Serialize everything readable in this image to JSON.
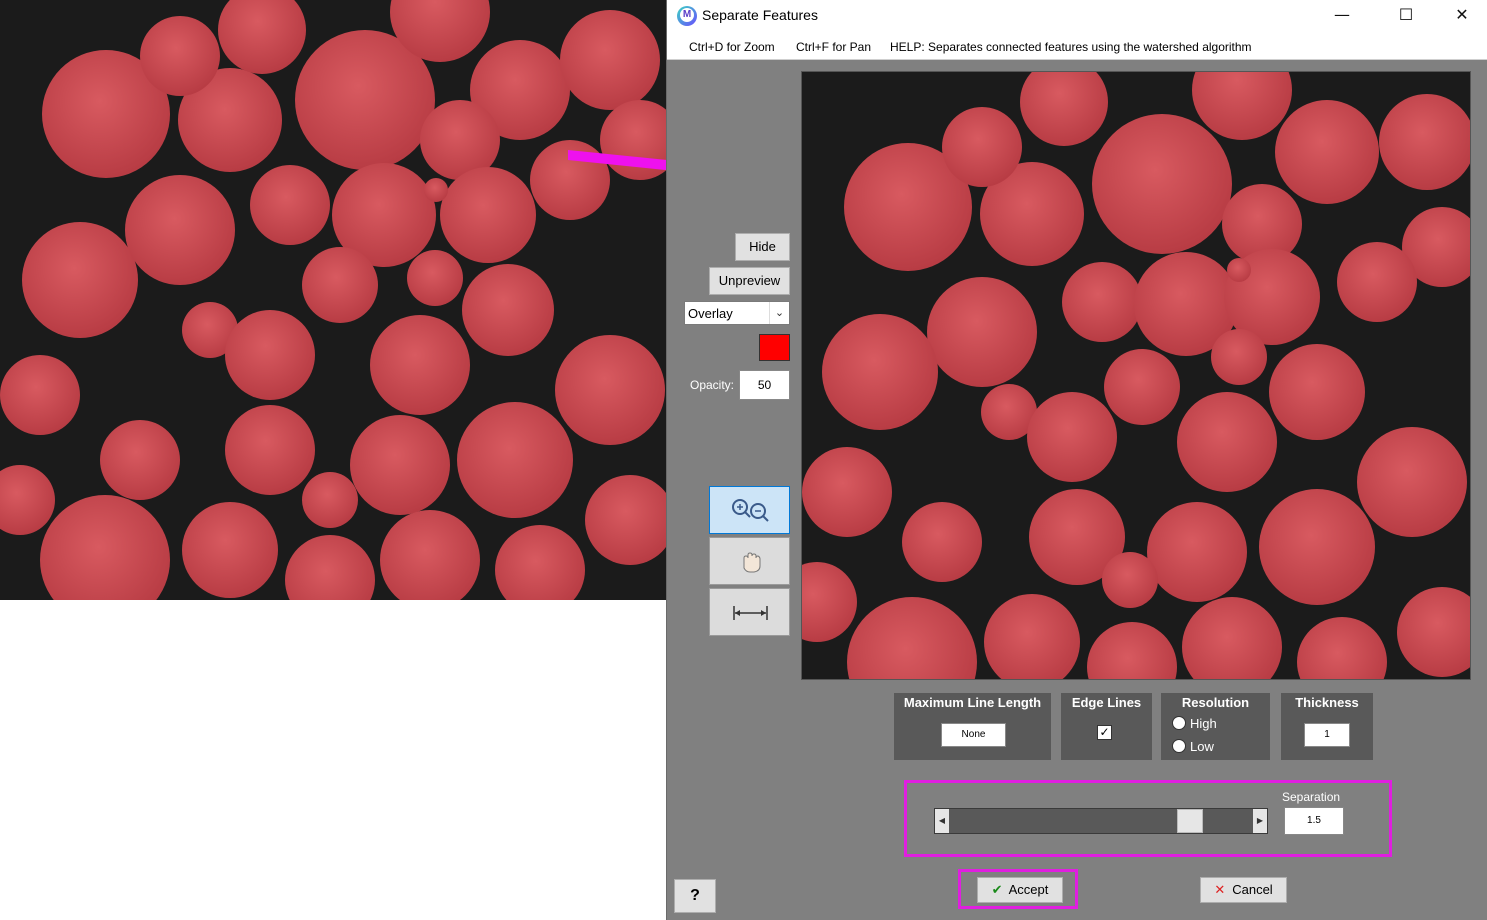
{
  "window": {
    "title": "Separate Features",
    "minimize_glyph": "—",
    "maximize_glyph": "☐",
    "close_glyph": "✕"
  },
  "menu": {
    "zoom": "Ctrl+D for Zoom",
    "pan": "Ctrl+F for Pan",
    "help": "HELP:  Separates connected features using the watershed algorithm"
  },
  "controls": {
    "hide_label": "Hide",
    "unpreview_label": "Unpreview",
    "overlay_value": "Overlay",
    "overlay_color": "#ff0000",
    "opacity_label": "Opacity:",
    "opacity_value": "50"
  },
  "tools": {
    "zoom": "zoom-in-out-icon",
    "pan": "hand-pan-icon",
    "measure": "measure-line-icon"
  },
  "options": {
    "max_line_length": {
      "title": "Maximum Line Length",
      "value": "None"
    },
    "edge_lines": {
      "title": "Edge Lines",
      "checked": true,
      "check_glyph": "✓"
    },
    "resolution": {
      "title": "Resolution",
      "options": [
        "High",
        "Low"
      ],
      "selected": "High"
    },
    "thickness": {
      "title": "Thickness",
      "value": "1"
    }
  },
  "separation": {
    "label": "Separation",
    "value": "1.5",
    "slider_fraction": 0.82
  },
  "buttons": {
    "help": "?",
    "accept": "Accept",
    "cancel": "Cancel",
    "accept_check": "✔",
    "cancel_x": "✕"
  },
  "colors": {
    "highlight": "#e01ee0",
    "particle": "#c8474d",
    "background": "#1a1a1a"
  }
}
